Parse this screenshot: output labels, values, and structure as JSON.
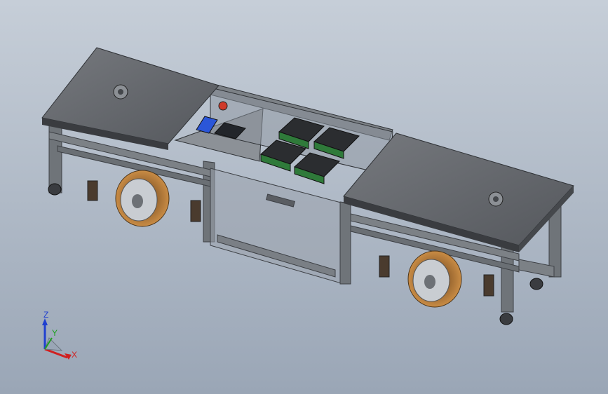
{
  "viewport": {
    "background_top": "#c6ced8",
    "background_bottom": "#9aa6b6",
    "model_colors": {
      "deck": "#5f6166",
      "deck_edge": "#3a3c40",
      "frame": "#6f7479",
      "wheel_tire": "#b07a3a",
      "wheel_hub": "#c9cdd2",
      "driver_box": "#2b2d30",
      "driver_board": "#2f7a3a",
      "estop": "#d03a2a",
      "display": "#2b56d8"
    }
  },
  "triad": {
    "x_label": "X",
    "y_label": "Y",
    "z_label": "Z",
    "x_color": "#d02020",
    "y_color": "#20a020",
    "z_color": "#2040d0"
  },
  "icons": [
    "view-triad-icon"
  ]
}
